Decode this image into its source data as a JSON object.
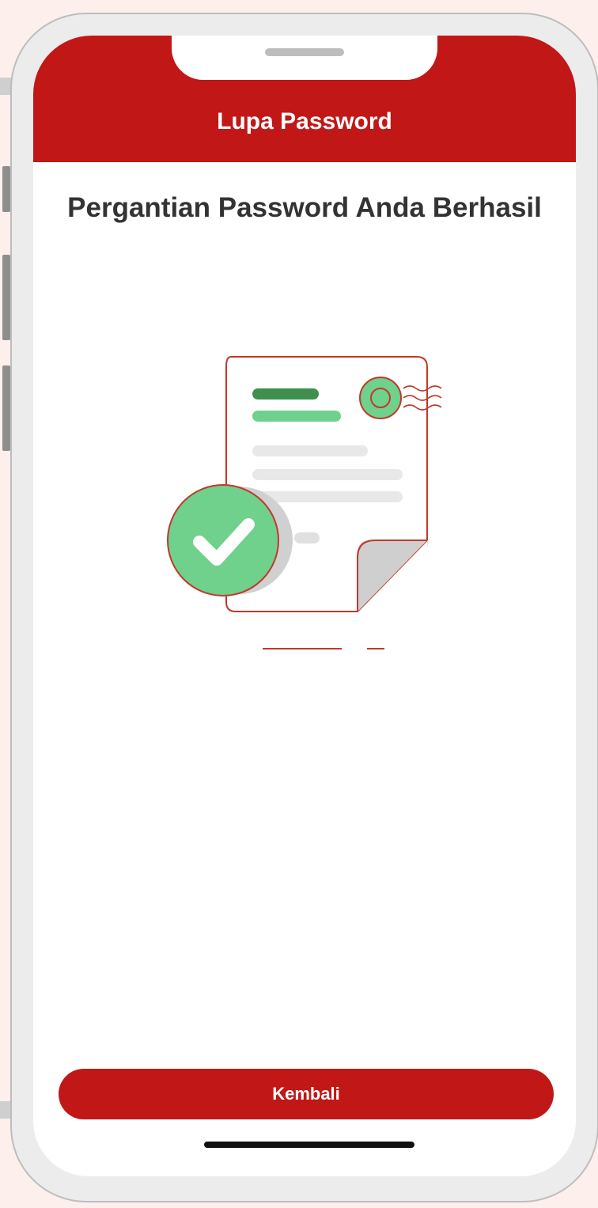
{
  "header": {
    "title": "Lupa Password"
  },
  "main": {
    "title": "Pergantian Password Anda Berhasil"
  },
  "actions": {
    "back_label": "Kembali"
  },
  "illustration": {
    "icon": "document-success-icon",
    "colors": {
      "outline": "#c0392b",
      "green_dark": "#3f8f4f",
      "green_light": "#6fd18b",
      "grey": "#e8e8e8"
    }
  },
  "theme": {
    "primary": "#c11717"
  }
}
